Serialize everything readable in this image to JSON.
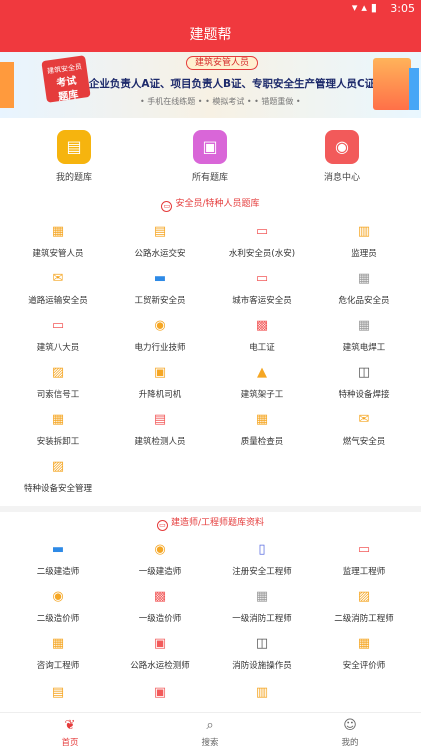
{
  "status_bar": {
    "time": "3:05",
    "icons": [
      "wifi-icon",
      "signal-icon",
      "battery-icon"
    ]
  },
  "app_bar": {
    "title": "建题帮"
  },
  "banner": {
    "badge_line1": "建筑安全员",
    "badge_line2": "考试",
    "badge_line3": "题库",
    "pill": "建筑安管人员",
    "headline": "企业负责人A证、项目负责人B证、专职安全生产管理人员C证",
    "sub": "• 手机在线练题 •   • 模拟考试 •   • 错题重做 •"
  },
  "quick_links": [
    {
      "label": "我的题库",
      "icon": "bookmark-icon",
      "color": "#f6b40e"
    },
    {
      "label": "所有题库",
      "icon": "grid-book-icon",
      "color": "#d966d8"
    },
    {
      "label": "消息中心",
      "icon": "person-bell-icon",
      "color": "#f25a5a"
    }
  ],
  "section1": {
    "title": "安全员/特种人员题库"
  },
  "section1_items": [
    {
      "label": "建筑安管人员",
      "icon": "grid-icon",
      "color": "#f5a623"
    },
    {
      "label": "公路水运交安",
      "icon": "document-icon",
      "color": "#f5a623"
    },
    {
      "label": "水利安全员(水安)",
      "icon": "ticket-icon",
      "color": "#f25a5a"
    },
    {
      "label": "监理员",
      "icon": "clipboard-icon",
      "color": "#f5a623"
    },
    {
      "label": "道路运输安全员",
      "icon": "mail-icon",
      "color": "#f5a623"
    },
    {
      "label": "工贸新安全员",
      "icon": "folder-icon",
      "color": "#2e8ae6"
    },
    {
      "label": "城市客运安全员",
      "icon": "ticket-icon",
      "color": "#f25a5a"
    },
    {
      "label": "危化品安全员",
      "icon": "grid-icon",
      "color": "#999999"
    },
    {
      "label": "建筑八大员",
      "icon": "ticket-icon",
      "color": "#f25a5a"
    },
    {
      "label": "电力行业技师",
      "icon": "coin-icon",
      "color": "#f5a623"
    },
    {
      "label": "电工证",
      "icon": "tag-icon",
      "color": "#f25a5a"
    },
    {
      "label": "建筑电焊工",
      "icon": "grid-icon",
      "color": "#999999"
    },
    {
      "label": "司索信号工",
      "icon": "image-icon",
      "color": "#f5a623"
    },
    {
      "label": "升降机司机",
      "icon": "card-icon",
      "color": "#f5a623"
    },
    {
      "label": "建筑架子工",
      "icon": "mountain-icon",
      "color": "#f5a623"
    },
    {
      "label": "特种设备焊接",
      "icon": "book-icon",
      "color": "#555555"
    },
    {
      "label": "安装拆卸工",
      "icon": "grid-icon",
      "color": "#f5a623"
    },
    {
      "label": "建筑检测人员",
      "icon": "document-icon",
      "color": "#f25a5a"
    },
    {
      "label": "质量检查员",
      "icon": "grid-icon",
      "color": "#f5a623"
    },
    {
      "label": "燃气安全员",
      "icon": "mail-icon",
      "color": "#f5a623"
    },
    {
      "label": "特种设备安全管理",
      "icon": "image-icon",
      "color": "#f5a623"
    }
  ],
  "section2": {
    "title": "建造师/工程师题库资料"
  },
  "section2_items": [
    {
      "label": "二级建造师",
      "icon": "folder-icon",
      "color": "#2e8ae6"
    },
    {
      "label": "一级建造师",
      "icon": "coin-icon",
      "color": "#f5a623"
    },
    {
      "label": "注册安全工程师",
      "icon": "building-icon",
      "color": "#5b6ee1"
    },
    {
      "label": "监理工程师",
      "icon": "ticket-icon",
      "color": "#f25a5a"
    },
    {
      "label": "二级造价师",
      "icon": "coin-icon",
      "color": "#f5a623"
    },
    {
      "label": "一级造价师",
      "icon": "tag-icon",
      "color": "#f25a5a"
    },
    {
      "label": "一级消防工程师",
      "icon": "grid-icon",
      "color": "#999999"
    },
    {
      "label": "二级消防工程师",
      "icon": "image-icon",
      "color": "#f5a623"
    },
    {
      "label": "咨询工程师",
      "icon": "grid-icon",
      "color": "#f5a623"
    },
    {
      "label": "公路水运检测师",
      "icon": "card-icon",
      "color": "#f25a5a"
    },
    {
      "label": "消防设施操作员",
      "icon": "book-icon",
      "color": "#555555"
    },
    {
      "label": "安全评价师",
      "icon": "grid-icon",
      "color": "#f5a623"
    }
  ],
  "section2_partial": [
    {
      "icon": "document-icon",
      "color": "#f5a623"
    },
    {
      "icon": "card-icon",
      "color": "#f25a5a"
    },
    {
      "icon": "clipboard-icon",
      "color": "#f5a623"
    }
  ],
  "tabbar": [
    {
      "label": "首页",
      "icon": "sprout-icon",
      "active": true
    },
    {
      "label": "搜索",
      "icon": "search-icon",
      "active": false
    },
    {
      "label": "我的",
      "icon": "user-icon",
      "active": false
    }
  ]
}
